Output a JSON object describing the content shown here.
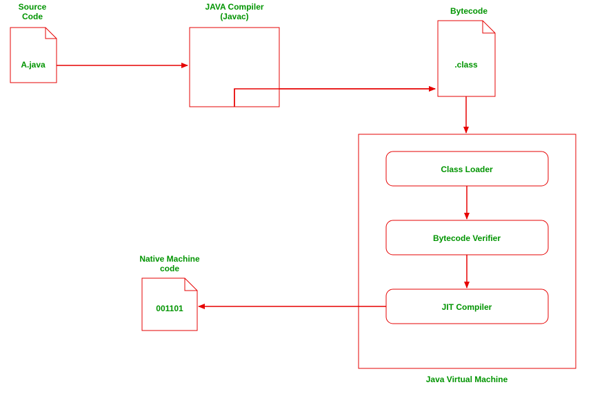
{
  "labels": {
    "source_code_l1": "Source",
    "source_code_l2": "Code",
    "compiler_l1": "JAVA Compiler",
    "compiler_l2": "(Javac)",
    "bytecode": "Bytecode",
    "native_l1": "Native Machine",
    "native_l2": "code",
    "jvm": "Java Virtual Machine"
  },
  "boxes": {
    "source_file": "A.java",
    "bytecode_file": ".class",
    "native_file": "001101",
    "class_loader": "Class Loader",
    "bytecode_verifier": "Bytecode Verifier",
    "jit_compiler": "JIT Compiler"
  }
}
